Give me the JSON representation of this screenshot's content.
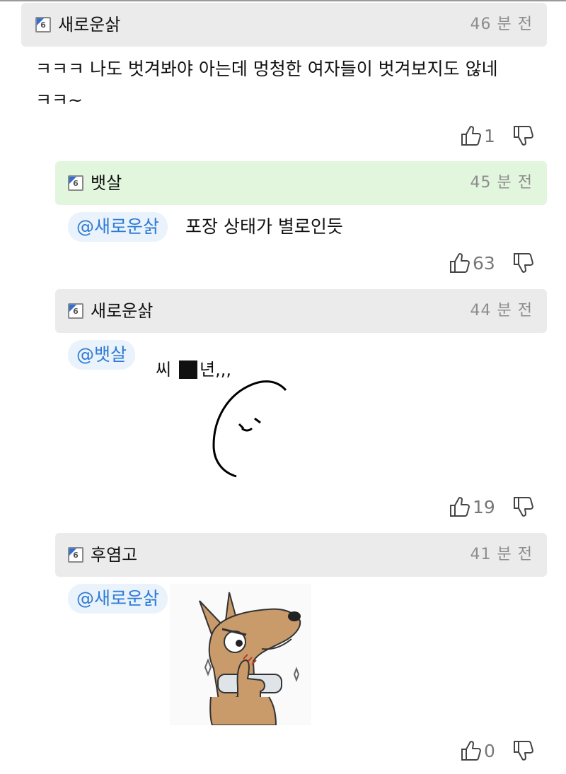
{
  "comments": [
    {
      "username": "새로운삵",
      "time": "46 분 전",
      "level": "6",
      "text": "ㅋㅋㅋ 나도 벗겨봐야 아는데 멍청한 여자들이 벗겨보지도 않네\nㅋㅋ~",
      "likes": "1"
    },
    {
      "username": "뱃살",
      "time": "45 분 전",
      "level": "6",
      "mention": "@새로운삵",
      "text": "포장 상태가 별로인듯",
      "likes": "63"
    },
    {
      "username": "새로운삵",
      "time": "44 분 전",
      "level": "6",
      "mention": "@뱃살",
      "sticker_text": "씨",
      "sticker_text2": "년,,,",
      "likes": "19"
    },
    {
      "username": "후염고",
      "time": "41 분 전",
      "level": "6",
      "mention": "@새로운삵",
      "likes": "0"
    }
  ],
  "colors": {
    "header_gray": "#ebebeb",
    "header_green": "#e2f6de",
    "mention_text": "#2d7bd6",
    "mention_bg": "#eaf2fb",
    "timestamp": "#8d8d8d"
  },
  "icons": [
    "level-icon",
    "thumbs-up-icon",
    "thumbs-down-icon"
  ]
}
